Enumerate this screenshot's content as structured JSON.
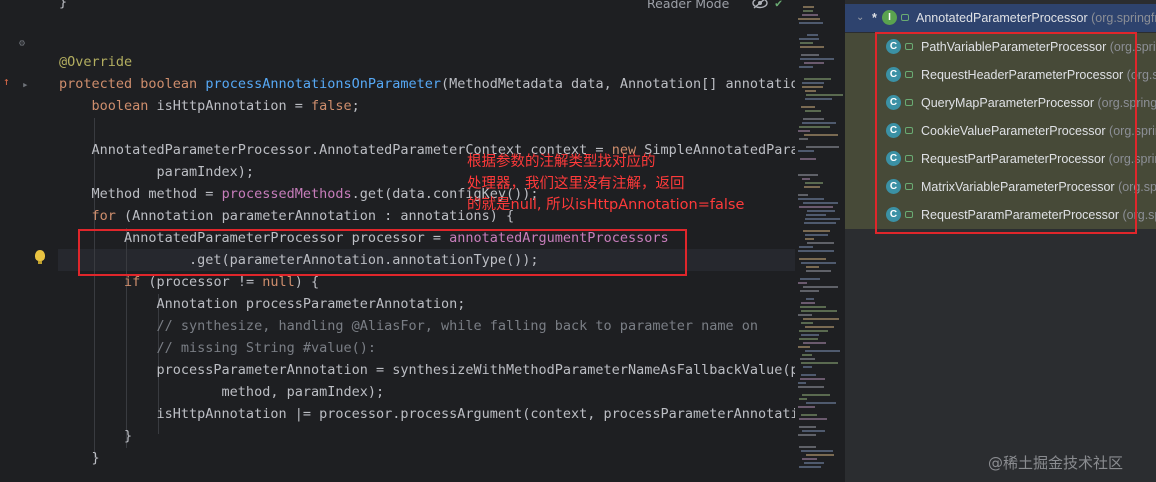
{
  "toolbar": {
    "reader_mode": "Reader Mode"
  },
  "editor": {
    "lines": [
      [
        {
          "t": "}",
          "c": "plain"
        }
      ],
      [
        {
          "t": "",
          "c": "plain"
        }
      ],
      [
        {
          "t": "@Override",
          "c": "ann"
        }
      ],
      [
        {
          "t": "protected ",
          "c": "kw"
        },
        {
          "t": "boolean ",
          "c": "kw"
        },
        {
          "t": "processAnnotationsOnParameter",
          "c": "fn"
        },
        {
          "t": "(MethodMetadata data, Annotation[] annotation",
          "c": "plain"
        }
      ],
      [
        {
          "t": "    ",
          "c": "plain"
        },
        {
          "t": "boolean ",
          "c": "kw"
        },
        {
          "t": "isHttpAnnotation = ",
          "c": "plain"
        },
        {
          "t": "false",
          "c": "kw"
        },
        {
          "t": ";",
          "c": "plain"
        }
      ],
      [
        {
          "t": "",
          "c": "plain"
        }
      ],
      [
        {
          "t": "    AnnotatedParameterProcessor.AnnotatedParameterContext context = ",
          "c": "plain"
        },
        {
          "t": "new ",
          "c": "kw"
        },
        {
          "t": "SimpleAnnotatedParam",
          "c": "plain"
        }
      ],
      [
        {
          "t": "            paramIndex);",
          "c": "plain"
        }
      ],
      [
        {
          "t": "    Method method = ",
          "c": "plain"
        },
        {
          "t": "processedMethods",
          "c": "fld"
        },
        {
          "t": ".get(data.configKey());",
          "c": "plain"
        }
      ],
      [
        {
          "t": "    ",
          "c": "plain"
        },
        {
          "t": "for ",
          "c": "kw"
        },
        {
          "t": "(Annotation parameterAnnotation : annotations) {",
          "c": "plain"
        }
      ],
      [
        {
          "t": "        AnnotatedParameterProcessor processor = ",
          "c": "plain"
        },
        {
          "t": "annotatedArgumentProcessors",
          "c": "fld"
        }
      ],
      [
        {
          "t": "                .get(parameterAnnotation.annotationType());",
          "c": "plain"
        }
      ],
      [
        {
          "t": "        ",
          "c": "plain"
        },
        {
          "t": "if ",
          "c": "kw"
        },
        {
          "t": "(processor != ",
          "c": "plain"
        },
        {
          "t": "null",
          "c": "kw"
        },
        {
          "t": ") {",
          "c": "plain"
        }
      ],
      [
        {
          "t": "            Annotation processParameterAnnotation;",
          "c": "plain"
        }
      ],
      [
        {
          "t": "            // synthesize, handling @AliasFor, while falling back to parameter name on",
          "c": "cm"
        }
      ],
      [
        {
          "t": "            // missing String #value():",
          "c": "cm"
        }
      ],
      [
        {
          "t": "            processParameterAnnotation = synthesizeWithMethodParameterNameAsFallbackValue(pa",
          "c": "plain"
        }
      ],
      [
        {
          "t": "                    method, paramIndex);",
          "c": "plain"
        }
      ],
      [
        {
          "t": "            isHttpAnnotation |= processor.processArgument(context, processParameterAnnotatio",
          "c": "plain"
        }
      ],
      [
        {
          "t": "        }",
          "c": "plain"
        }
      ],
      [
        {
          "t": "    }",
          "c": "plain"
        }
      ]
    ]
  },
  "annotation": {
    "line1": "根据参数的注解类型找对应的",
    "line2": "处理器，我们这里没有注解，返回",
    "line3": "的就是null, 所以isHttpAnnotation=false"
  },
  "hierarchy": {
    "root": {
      "name": "AnnotatedParameterProcessor",
      "pkg": " (org.springfr"
    },
    "children": [
      {
        "name": "PathVariableParameterProcessor",
        "pkg": " (org.sprin"
      },
      {
        "name": "RequestHeaderParameterProcessor",
        "pkg": " (org.sprin"
      },
      {
        "name": "QueryMapParameterProcessor",
        "pkg": " (org.springf"
      },
      {
        "name": "CookieValueParameterProcessor",
        "pkg": " (org.sprin"
      },
      {
        "name": "RequestPartParameterProcessor",
        "pkg": " (org.sprin"
      },
      {
        "name": "MatrixVariableParameterProcessor",
        "pkg": " (org.spri"
      },
      {
        "name": "RequestParamParameterProcessor",
        "pkg": " (org.spri"
      }
    ]
  },
  "watermark": "@稀土掘金技术社区",
  "colors": {
    "editor_bg": "#1e1f22",
    "keyword": "#cf8e6d",
    "method": "#56a8f5",
    "field": "#c77dbb",
    "annotation": "#b3ae60",
    "comment": "#7a7e85",
    "highlight_red": "#e0262b",
    "selected_row": "#2e436e"
  },
  "icons": {
    "class_badge": "C",
    "interface_badge": "I",
    "lightbulb": "lightbulb-icon",
    "reader_toggle": "eye-slash-icon"
  }
}
